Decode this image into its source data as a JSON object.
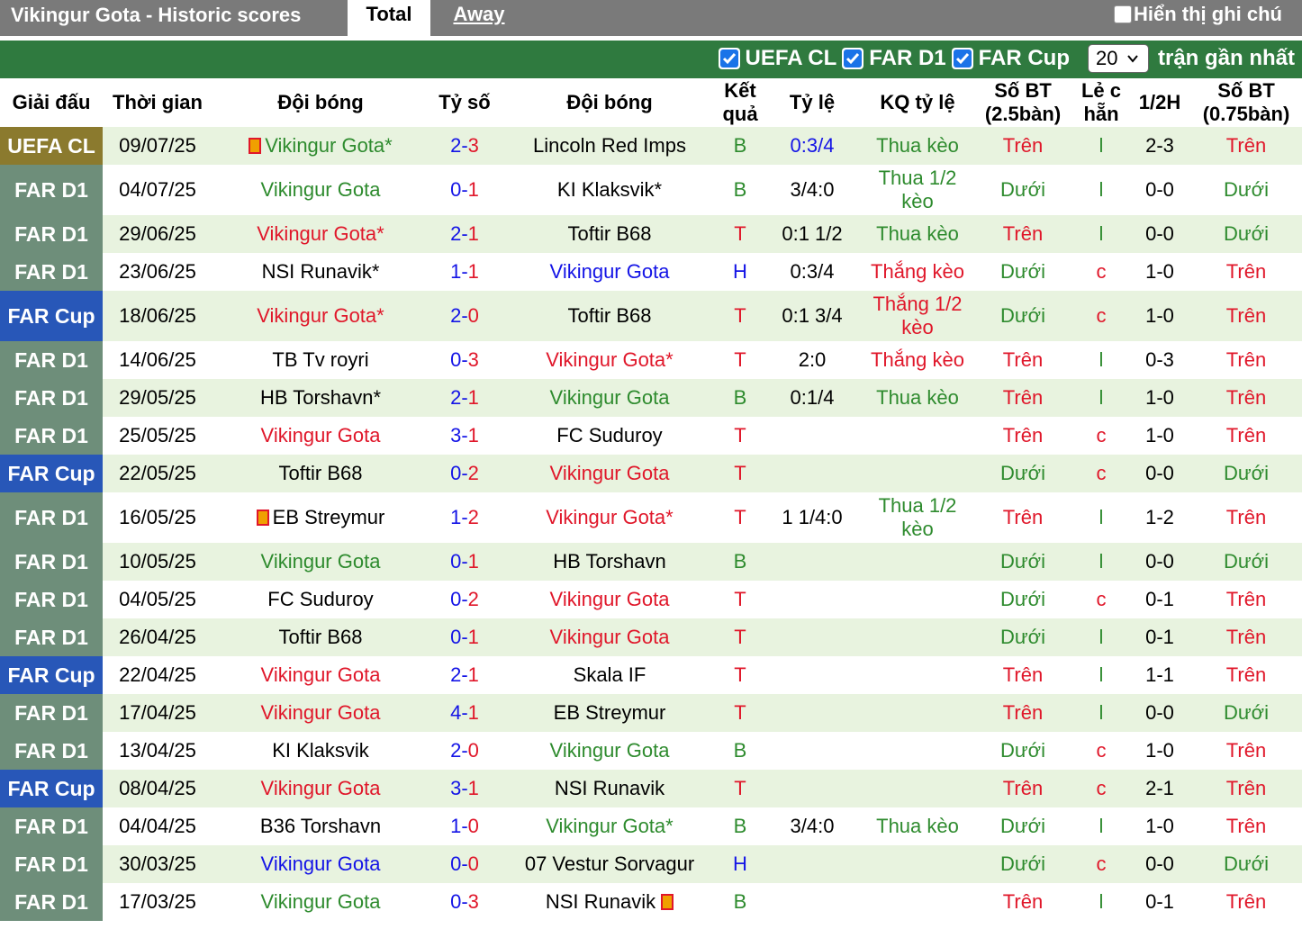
{
  "header": {
    "title": "Vikingur Gota - Historic scores",
    "tab_total": "Total",
    "tab_away": "Away",
    "show_notes": "Hiển thị ghi chú"
  },
  "filters": {
    "items": [
      "UEFA CL",
      "FAR D1",
      "FAR Cup"
    ],
    "count_value": "20",
    "recent_label": "trận gần nhất"
  },
  "colors": {
    "uefa": "#8b7a2e",
    "far_d1": "#6e8e7a",
    "far_cup": "#2857b8",
    "win": "#e0172a",
    "draw": "#1414e6",
    "loss": "#2e8b2e"
  },
  "columns": [
    "Giải đấu",
    "Thời gian",
    "Đội bóng",
    "Tỷ số",
    "Đội bóng",
    "Kết quả",
    "Tỷ lệ",
    "KQ tỷ lệ",
    "Số BT (2.5bàn)",
    "Lẻ c hẵn",
    "1/2H",
    "Số BT (0.75bàn)"
  ],
  "rows": [
    {
      "league": "UEFA CL",
      "lt": "uefa",
      "date": "09/07/25",
      "home": "Vikingur Gota*",
      "hc": "green",
      "hflag": true,
      "score": "2-3",
      "away": "Lincoln Red Imps",
      "ac": "black",
      "aflag": false,
      "res": "B",
      "odds": "0:3/4",
      "oc": "blue",
      "kq": "Thua kèo",
      "kc": "green",
      "ou": "Trên",
      "uc": "red",
      "oe": "l",
      "half": "2-3",
      "ou2": "Trên",
      "u2c": "red"
    },
    {
      "league": "FAR D1",
      "lt": "far_d1",
      "date": "04/07/25",
      "home": "Vikingur Gota",
      "hc": "green",
      "hflag": false,
      "score": "0-1",
      "away": "KI Klaksvik*",
      "ac": "black",
      "aflag": false,
      "res": "B",
      "odds": "3/4:0",
      "oc": "black",
      "kq": "Thua 1/2 kèo",
      "kc": "green",
      "ou": "Dưới",
      "uc": "green",
      "oe": "l",
      "half": "0-0",
      "ou2": "Dưới",
      "u2c": "green"
    },
    {
      "league": "FAR D1",
      "lt": "far_d1",
      "date": "29/06/25",
      "home": "Vikingur Gota*",
      "hc": "red",
      "hflag": false,
      "score": "2-1",
      "away": "Toftir B68",
      "ac": "black",
      "aflag": false,
      "res": "T",
      "odds": "0:1 1/2",
      "oc": "black",
      "kq": "Thua kèo",
      "kc": "green",
      "ou": "Trên",
      "uc": "red",
      "oe": "l",
      "half": "0-0",
      "ou2": "Dưới",
      "u2c": "green"
    },
    {
      "league": "FAR D1",
      "lt": "far_d1",
      "date": "23/06/25",
      "home": "NSI Runavik*",
      "hc": "black",
      "hflag": false,
      "score": "1-1",
      "away": "Vikingur Gota",
      "ac": "blue",
      "aflag": false,
      "res": "H",
      "odds": "0:3/4",
      "oc": "black",
      "kq": "Thắng kèo",
      "kc": "red",
      "ou": "Dưới",
      "uc": "green",
      "oe": "c",
      "half": "1-0",
      "ou2": "Trên",
      "u2c": "red"
    },
    {
      "league": "FAR Cup",
      "lt": "far_cup",
      "date": "18/06/25",
      "home": "Vikingur Gota*",
      "hc": "red",
      "hflag": false,
      "score": "2-0",
      "away": "Toftir B68",
      "ac": "black",
      "aflag": false,
      "res": "T",
      "odds": "0:1 3/4",
      "oc": "black",
      "kq": "Thắng 1/2 kèo",
      "kc": "red",
      "ou": "Dưới",
      "uc": "green",
      "oe": "c",
      "half": "1-0",
      "ou2": "Trên",
      "u2c": "red"
    },
    {
      "league": "FAR D1",
      "lt": "far_d1",
      "date": "14/06/25",
      "home": "TB Tv royri",
      "hc": "black",
      "hflag": false,
      "score": "0-3",
      "away": "Vikingur Gota*",
      "ac": "red",
      "aflag": false,
      "res": "T",
      "odds": "2:0",
      "oc": "black",
      "kq": "Thắng kèo",
      "kc": "red",
      "ou": "Trên",
      "uc": "red",
      "oe": "l",
      "half": "0-3",
      "ou2": "Trên",
      "u2c": "red"
    },
    {
      "league": "FAR D1",
      "lt": "far_d1",
      "date": "29/05/25",
      "home": "HB Torshavn*",
      "hc": "black",
      "hflag": false,
      "score": "2-1",
      "away": "Vikingur Gota",
      "ac": "green",
      "aflag": false,
      "res": "B",
      "odds": "0:1/4",
      "oc": "black",
      "kq": "Thua kèo",
      "kc": "green",
      "ou": "Trên",
      "uc": "red",
      "oe": "l",
      "half": "1-0",
      "ou2": "Trên",
      "u2c": "red"
    },
    {
      "league": "FAR D1",
      "lt": "far_d1",
      "date": "25/05/25",
      "home": "Vikingur Gota",
      "hc": "red",
      "hflag": false,
      "score": "3-1",
      "away": "FC Suduroy",
      "ac": "black",
      "aflag": false,
      "res": "T",
      "odds": "",
      "oc": "black",
      "kq": "",
      "kc": "green",
      "ou": "Trên",
      "uc": "red",
      "oe": "c",
      "half": "1-0",
      "ou2": "Trên",
      "u2c": "red"
    },
    {
      "league": "FAR Cup",
      "lt": "far_cup",
      "date": "22/05/25",
      "home": "Toftir B68",
      "hc": "black",
      "hflag": false,
      "score": "0-2",
      "away": "Vikingur Gota",
      "ac": "red",
      "aflag": false,
      "res": "T",
      "odds": "",
      "oc": "black",
      "kq": "",
      "kc": "green",
      "ou": "Dưới",
      "uc": "green",
      "oe": "c",
      "half": "0-0",
      "ou2": "Dưới",
      "u2c": "green"
    },
    {
      "league": "FAR D1",
      "lt": "far_d1",
      "date": "16/05/25",
      "home": "EB Streymur",
      "hc": "black",
      "hflag": true,
      "score": "1-2",
      "away": "Vikingur Gota*",
      "ac": "red",
      "aflag": false,
      "res": "T",
      "odds": "1 1/4:0",
      "oc": "black",
      "kq": "Thua 1/2 kèo",
      "kc": "green",
      "ou": "Trên",
      "uc": "red",
      "oe": "l",
      "half": "1-2",
      "ou2": "Trên",
      "u2c": "red"
    },
    {
      "league": "FAR D1",
      "lt": "far_d1",
      "date": "10/05/25",
      "home": "Vikingur Gota",
      "hc": "green",
      "hflag": false,
      "score": "0-1",
      "away": "HB Torshavn",
      "ac": "black",
      "aflag": false,
      "res": "B",
      "odds": "",
      "oc": "black",
      "kq": "",
      "kc": "green",
      "ou": "Dưới",
      "uc": "green",
      "oe": "l",
      "half": "0-0",
      "ou2": "Dưới",
      "u2c": "green"
    },
    {
      "league": "FAR D1",
      "lt": "far_d1",
      "date": "04/05/25",
      "home": "FC Suduroy",
      "hc": "black",
      "hflag": false,
      "score": "0-2",
      "away": "Vikingur Gota",
      "ac": "red",
      "aflag": false,
      "res": "T",
      "odds": "",
      "oc": "black",
      "kq": "",
      "kc": "green",
      "ou": "Dưới",
      "uc": "green",
      "oe": "c",
      "half": "0-1",
      "ou2": "Trên",
      "u2c": "red"
    },
    {
      "league": "FAR D1",
      "lt": "far_d1",
      "date": "26/04/25",
      "home": "Toftir B68",
      "hc": "black",
      "hflag": false,
      "score": "0-1",
      "away": "Vikingur Gota",
      "ac": "red",
      "aflag": false,
      "res": "T",
      "odds": "",
      "oc": "black",
      "kq": "",
      "kc": "green",
      "ou": "Dưới",
      "uc": "green",
      "oe": "l",
      "half": "0-1",
      "ou2": "Trên",
      "u2c": "red"
    },
    {
      "league": "FAR Cup",
      "lt": "far_cup",
      "date": "22/04/25",
      "home": "Vikingur Gota",
      "hc": "red",
      "hflag": false,
      "score": "2-1",
      "away": "Skala IF",
      "ac": "black",
      "aflag": false,
      "res": "T",
      "odds": "",
      "oc": "black",
      "kq": "",
      "kc": "green",
      "ou": "Trên",
      "uc": "red",
      "oe": "l",
      "half": "1-1",
      "ou2": "Trên",
      "u2c": "red"
    },
    {
      "league": "FAR D1",
      "lt": "far_d1",
      "date": "17/04/25",
      "home": "Vikingur Gota",
      "hc": "red",
      "hflag": false,
      "score": "4-1",
      "away": "EB Streymur",
      "ac": "black",
      "aflag": false,
      "res": "T",
      "odds": "",
      "oc": "black",
      "kq": "",
      "kc": "green",
      "ou": "Trên",
      "uc": "red",
      "oe": "l",
      "half": "0-0",
      "ou2": "Dưới",
      "u2c": "green"
    },
    {
      "league": "FAR D1",
      "lt": "far_d1",
      "date": "13/04/25",
      "home": "KI Klaksvik",
      "hc": "black",
      "hflag": false,
      "score": "2-0",
      "away": "Vikingur Gota",
      "ac": "green",
      "aflag": false,
      "res": "B",
      "odds": "",
      "oc": "black",
      "kq": "",
      "kc": "green",
      "ou": "Dưới",
      "uc": "green",
      "oe": "c",
      "half": "1-0",
      "ou2": "Trên",
      "u2c": "red"
    },
    {
      "league": "FAR Cup",
      "lt": "far_cup",
      "date": "08/04/25",
      "home": "Vikingur Gota",
      "hc": "red",
      "hflag": false,
      "score": "3-1",
      "away": "NSI Runavik",
      "ac": "black",
      "aflag": false,
      "res": "T",
      "odds": "",
      "oc": "black",
      "kq": "",
      "kc": "green",
      "ou": "Trên",
      "uc": "red",
      "oe": "c",
      "half": "2-1",
      "ou2": "Trên",
      "u2c": "red"
    },
    {
      "league": "FAR D1",
      "lt": "far_d1",
      "date": "04/04/25",
      "home": "B36 Torshavn",
      "hc": "black",
      "hflag": false,
      "score": "1-0",
      "away": "Vikingur Gota*",
      "ac": "green",
      "aflag": false,
      "res": "B",
      "odds": "3/4:0",
      "oc": "black",
      "kq": "Thua kèo",
      "kc": "green",
      "ou": "Dưới",
      "uc": "green",
      "oe": "l",
      "half": "1-0",
      "ou2": "Trên",
      "u2c": "red"
    },
    {
      "league": "FAR D1",
      "lt": "far_d1",
      "date": "30/03/25",
      "home": "Vikingur Gota",
      "hc": "blue",
      "hflag": false,
      "score": "0-0",
      "away": "07 Vestur Sorvagur",
      "ac": "black",
      "aflag": false,
      "res": "H",
      "odds": "",
      "oc": "black",
      "kq": "",
      "kc": "green",
      "ou": "Dưới",
      "uc": "green",
      "oe": "c",
      "half": "0-0",
      "ou2": "Dưới",
      "u2c": "green"
    },
    {
      "league": "FAR D1",
      "lt": "far_d1",
      "date": "17/03/25",
      "home": "Vikingur Gota",
      "hc": "green",
      "hflag": false,
      "score": "0-3",
      "away": "NSI Runavik",
      "ac": "black",
      "aflag": true,
      "res": "B",
      "odds": "",
      "oc": "black",
      "kq": "",
      "kc": "green",
      "ou": "Trên",
      "uc": "red",
      "oe": "l",
      "half": "0-1",
      "ou2": "Trên",
      "u2c": "red"
    }
  ]
}
